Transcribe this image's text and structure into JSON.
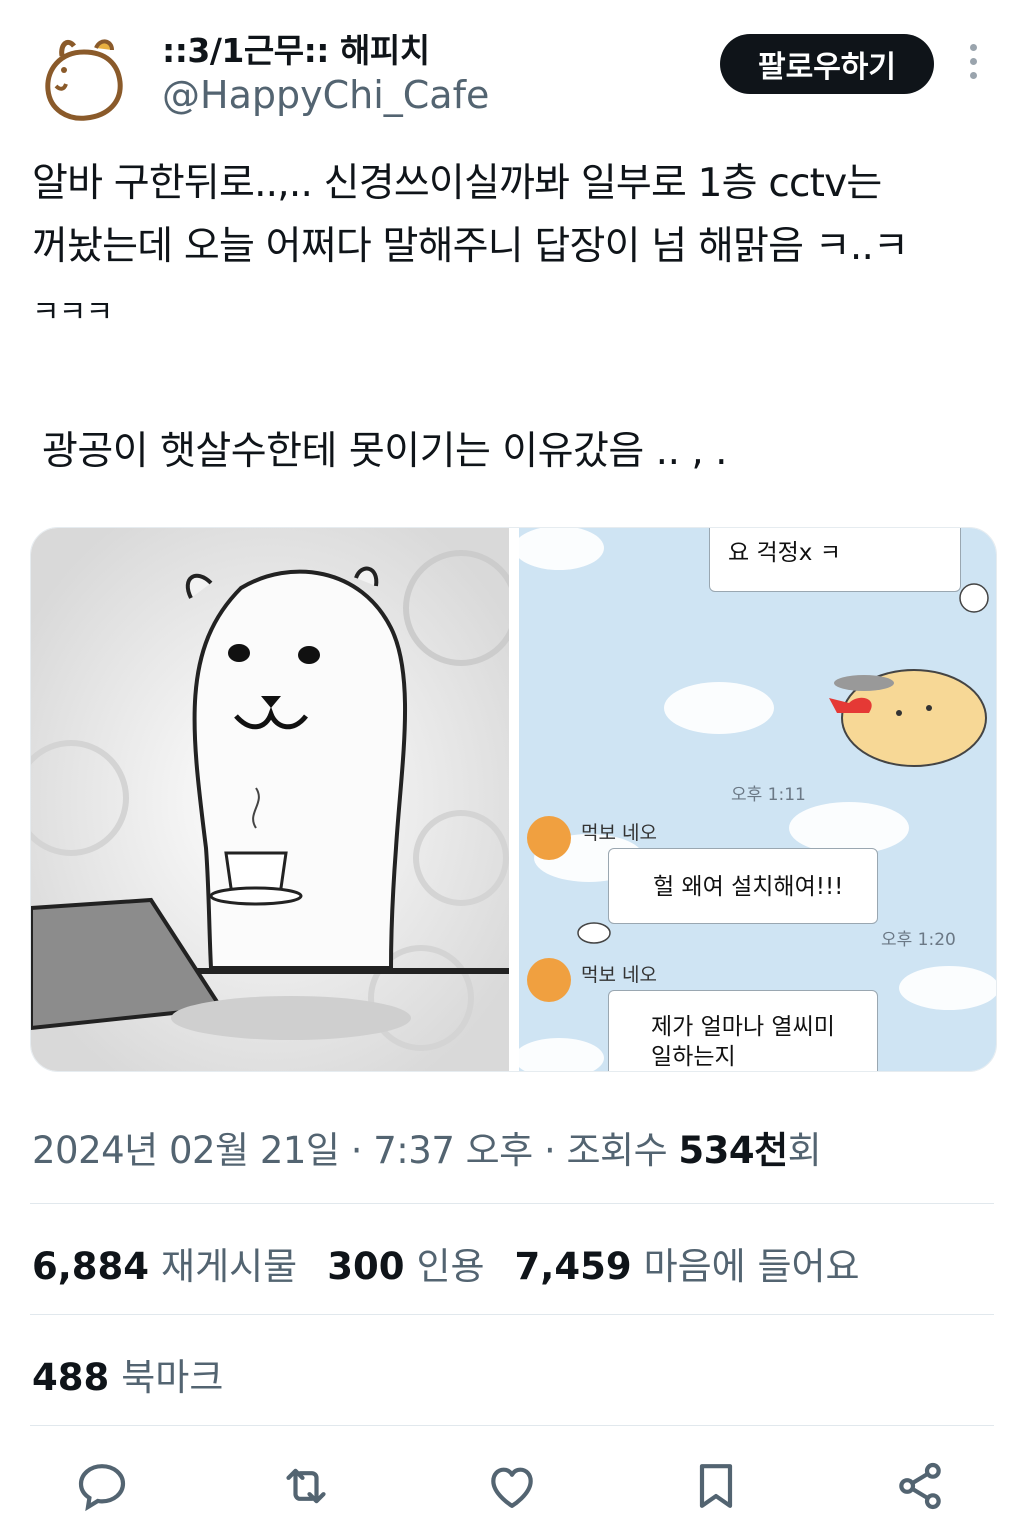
{
  "header": {
    "display_name": "::3/1근무:: 해피치",
    "handle": "@HappyChi_Cafe",
    "follow_label": "팔로우하기"
  },
  "tweet": {
    "line1": "알바 구한뒤로..,.. 신경쓰이실까봐 일부로 1층 cctv는",
    "line2": "꺼놨는데 오늘 어쩌다 말해주니 답장이 넘 해맑음 ㅋ..ㅋ",
    "line3": "ㅋㅋㅋ",
    "line4": "광공이 햇살수한테 못이기는 이유갔음 .. , ."
  },
  "chat": {
    "top_bubble": "요 걱정x ㅋ",
    "time1": "오후 1:11",
    "sender1": "먹보 네오",
    "msg1": "헐 왜여 설치해여!!!",
    "time2": "오후 1:20",
    "sender2": "먹보 네오",
    "msg2_line1": "제가 얼마나 열씨미",
    "msg2_line2": "일하는지"
  },
  "meta": {
    "date": "2024년 02월 21일",
    "sep1": " · ",
    "time": "7:37 오후",
    "sep2": " · ",
    "views_label": "조회수 ",
    "views_value": "534천",
    "views_suffix": "회"
  },
  "stats": {
    "retweets_value": "6,884",
    "retweets_label": "재게시물",
    "quotes_value": "300",
    "quotes_label": "인용",
    "likes_value": "7,459",
    "likes_label": "마음에 들어요",
    "bookmarks_value": "488",
    "bookmarks_label": "북마크"
  },
  "actions": [
    "reply-icon",
    "retweet-icon",
    "like-icon",
    "bookmark-icon",
    "share-icon"
  ],
  "colors": {
    "text_primary": "#0f1419",
    "text_secondary": "#536471",
    "chat_bg": "#cfe4f3",
    "follow_bg": "#0f1419"
  }
}
